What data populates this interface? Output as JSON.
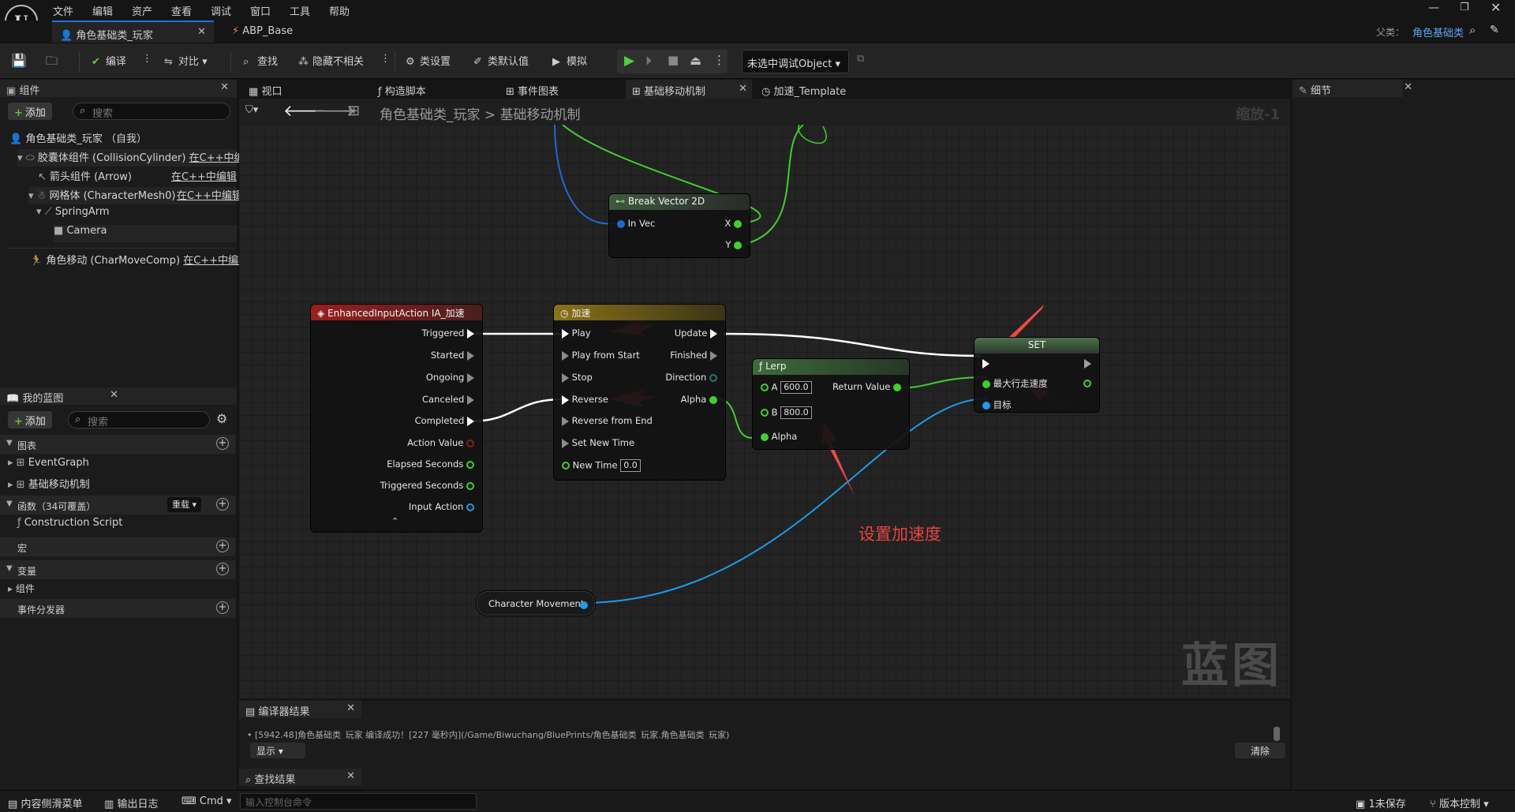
{
  "menu": [
    "文件",
    "编辑",
    "资产",
    "查看",
    "调试",
    "窗口",
    "工具",
    "帮助"
  ],
  "logo_text": "U",
  "doc_tabs": [
    {
      "label": "角色基础类_玩家"
    },
    {
      "label": "ABP_Base"
    }
  ],
  "parent_label": "父类：",
  "parent_value": "角色基础类",
  "toolbar": {
    "compile": "编译",
    "diff": "对比",
    "find": "查找",
    "hide_unrelated": "隐藏不相关",
    "class_settings": "类设置",
    "class_defaults": "类默认值",
    "simulate": "模拟",
    "debug_object": "未选中调试Object"
  },
  "components_panel": {
    "title": "组件",
    "add": "添加",
    "search_placeholder": "搜索",
    "items": [
      {
        "label": "角色基础类_玩家 （自我）",
        "link": ""
      },
      {
        "label": "胶囊体组件 (CollisionCylinder)",
        "link": "在C++中编"
      },
      {
        "label": "箭头组件 (Arrow)",
        "link": "在C++中编辑"
      },
      {
        "label": "网格体 (CharacterMesh0)",
        "link": "在C++中编辑"
      },
      {
        "label": "SpringArm",
        "link": ""
      },
      {
        "label": "Camera",
        "link": ""
      },
      {
        "label": "角色移动 (CharMoveComp)",
        "link": "在C++中编辑"
      }
    ]
  },
  "my_blueprint": {
    "title": "我的蓝图",
    "add": "添加",
    "search_placeholder": "搜索",
    "graphs_label": "图表",
    "graph_items": [
      "EventGraph",
      "基础移动机制"
    ],
    "functions_label": "函数（34可覆盖）",
    "override_label": "重载",
    "construction_script": "Construction Script",
    "macros_label": "宏",
    "variables_label": "变量",
    "components_label": "组件",
    "dispatchers_label": "事件分发器"
  },
  "details_panel": {
    "title": "细节"
  },
  "graph_tabs": [
    "视口",
    "构造脚本",
    "事件图表",
    "基础移动机制",
    "加速_Template"
  ],
  "breadcrumb": {
    "root": "角色基础类_玩家",
    "current": "基础移动机制",
    "zoom": "缩放-1"
  },
  "nodes": {
    "break_vector": {
      "title": "Break Vector 2D",
      "in_vec": "In Vec",
      "x": "X",
      "y": "Y"
    },
    "input_action": {
      "title": "EnhancedInputAction IA_加速",
      "pins": [
        "Triggered",
        "Started",
        "Ongoing",
        "Canceled",
        "Completed",
        "Action Value",
        "Elapsed Seconds",
        "Triggered Seconds",
        "Input Action"
      ]
    },
    "timeline": {
      "title": "加速",
      "inputs": [
        "Play",
        "Play from Start",
        "Stop",
        "Reverse",
        "Reverse from End",
        "Set New Time",
        "New Time"
      ],
      "new_time": "0.0",
      "outputs": [
        "Update",
        "Finished",
        "Direction",
        "Alpha"
      ]
    },
    "lerp": {
      "title": "Lerp",
      "a_label": "A",
      "a": "600.0",
      "b_label": "B",
      "b": "800.0",
      "alpha": "Alpha",
      "return_value": "Return Value"
    },
    "set": {
      "title": "SET",
      "max_walk": "最大行走速度",
      "target": "目标"
    },
    "char_movement": {
      "title": "Character Movement"
    }
  },
  "annotation": "设置加速度",
  "watermark": "蓝图",
  "compiler": {
    "title": "编译器结果",
    "message": "[5942.48]角色基础类_玩家 编译成功！[227 毫秒内](/Game/Biwuchang/BluePrints/角色基础类_玩家.角色基础类_玩家)",
    "show": "显示",
    "clear": "清除"
  },
  "find_results": {
    "title": "查找结果"
  },
  "bottom": {
    "content_drawer": "内容侧滑菜单",
    "output_log": "输出日志",
    "cmd": "Cmd",
    "console_placeholder": "输入控制台命令",
    "unsaved": "1未保存",
    "source_control": "版本控制"
  },
  "colors": {
    "exec": "#ffffff",
    "float": "#3fd12b",
    "object": "#1b9be8",
    "input_header": "#8a1c1c",
    "timeline_header": "#7a6414",
    "lerp_header": "#3e6b3b",
    "set_header": "#2e4a2e",
    "annotation": "#e6463f",
    "arrow": "#ef4747"
  }
}
